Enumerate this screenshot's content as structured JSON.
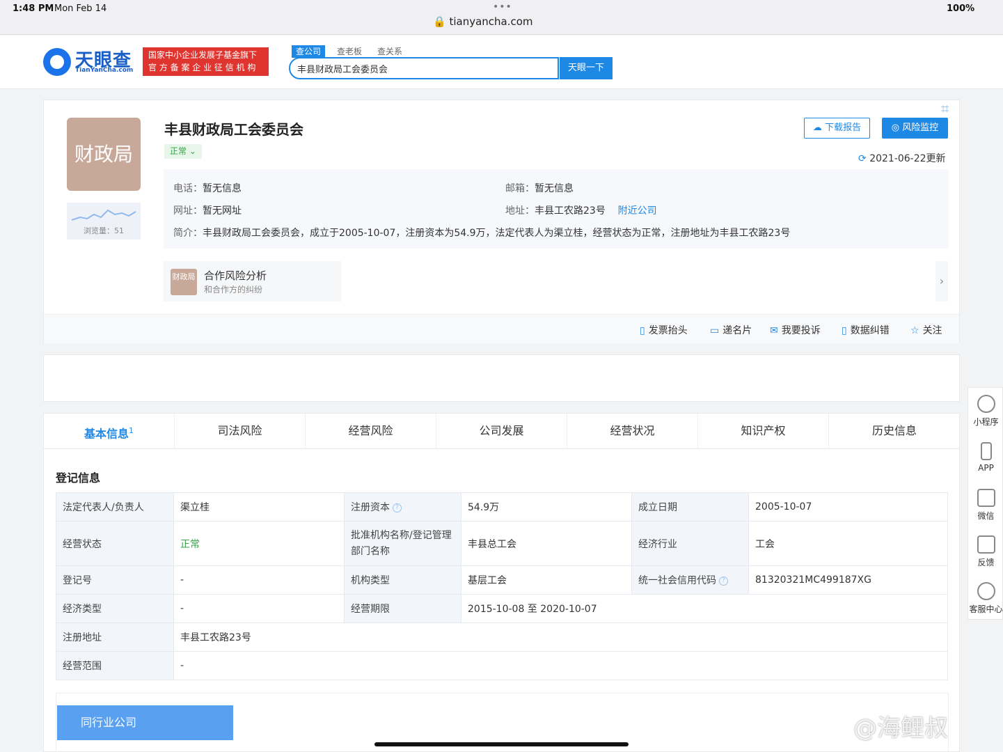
{
  "status_bar": {
    "time": "1:48 PM",
    "date": "Mon Feb 14",
    "url": "tianyancha.com",
    "battery": "100%"
  },
  "header": {
    "logo_cn": "天眼查",
    "logo_en": "TianYanCha.com",
    "badge_line1": "国家中小企业发展子基金旗下",
    "badge_line2": "官 方 备 案 企 业 征 信 机 构",
    "search_tabs": [
      "查公司",
      "查老板",
      "查关系"
    ],
    "search_value": "丰县财政局工会委员会",
    "search_button": "天眼一下"
  },
  "company": {
    "avatar_text": "财政局",
    "views_label": "浏览量：51",
    "name": "丰县财政局工会委员会",
    "status": "正常",
    "download_btn": "下载报告",
    "monitor_btn": "风险监控",
    "updated": "2021-06-22更新",
    "phone_label": "电话：",
    "phone": "暂无信息",
    "email_label": "邮箱：",
    "email": "暂无信息",
    "website_label": "网址：",
    "website": "暂无网址",
    "address_label": "地址：",
    "address": "丰县工农路23号",
    "nearby": "附近公司",
    "intro_label": "简介：",
    "intro": "丰县财政局工会委员会，成立于2005-10-07，注册资本为54.9万，法定代表人为渠立桂，经营状态为正常，注册地址为丰县工农路23号",
    "coop_icon": "财政局",
    "coop_title": "合作风险分析",
    "coop_sub": "和合作方的纠纷",
    "actions": [
      "发票抬头",
      "递名片",
      "我要投诉",
      "数据纠错",
      "关注"
    ]
  },
  "tabs": [
    {
      "label": "基本信息",
      "count": "1"
    },
    {
      "label": "司法风险"
    },
    {
      "label": "经营风险"
    },
    {
      "label": "公司发展"
    },
    {
      "label": "经营状况"
    },
    {
      "label": "知识产权"
    },
    {
      "label": "历史信息"
    }
  ],
  "registration": {
    "title": "登记信息",
    "legal_rep_k": "法定代表人/负责人",
    "legal_rep_v": "渠立桂",
    "capital_k": "注册资本",
    "capital_v": "54.9万",
    "founded_k": "成立日期",
    "founded_v": "2005-10-07",
    "status_k": "经营状态",
    "status_v": "正常",
    "approval_k": "批准机构名称/登记管理部门名称",
    "approval_v": "丰县总工会",
    "industry_k": "经济行业",
    "industry_v": "工会",
    "regno_k": "登记号",
    "regno_v": "-",
    "orgtype_k": "机构类型",
    "orgtype_v": "基层工会",
    "credit_k": "统一社会信用代码",
    "credit_v": "81320321MC499187XG",
    "econtype_k": "经济类型",
    "econtype_v": "-",
    "term_k": "经营期限",
    "term_v": "2015-10-08 至 2020-10-07",
    "regaddr_k": "注册地址",
    "regaddr_v": "丰县工农路23号",
    "scope_k": "经营范围",
    "scope_v": "-"
  },
  "peer_button": "同行业公司",
  "float_menu": [
    "小程序",
    "APP",
    "微信",
    "反馈",
    "客服中心"
  ],
  "watermark": "@海鲤叔"
}
